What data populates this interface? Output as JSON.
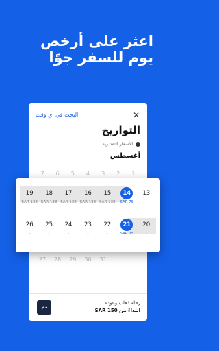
{
  "promo": {
    "headline": "اعثر على أرخص يوم للسفر جوًا"
  },
  "panel": {
    "anytime_link": "البحث في أي وقت",
    "close_icon": "close-icon",
    "title": "التواريخ",
    "estimated_note": "الأسعار التقديرية",
    "info_icon": "info-icon",
    "month": "أغسطس"
  },
  "faded_top_row": [
    "7",
    "6",
    "5",
    "4",
    "3",
    "2",
    "1"
  ],
  "faded_bottom_row": [
    "27",
    "28",
    "29",
    "30",
    "31",
    "",
    ""
  ],
  "calendar": {
    "weeks": [
      {
        "days": [
          {
            "day": "13",
            "price": "-",
            "selected": false,
            "in_range": false
          },
          {
            "day": "14",
            "price": "SAR 75",
            "selected": true,
            "in_range": true
          },
          {
            "day": "15",
            "price": "SAR 138",
            "selected": false,
            "in_range": true
          },
          {
            "day": "16",
            "price": "SAR 138",
            "selected": false,
            "in_range": true
          },
          {
            "day": "17",
            "price": "SAR 138",
            "selected": false,
            "in_range": true
          },
          {
            "day": "18",
            "price": "SAR 138",
            "selected": false,
            "in_range": true
          },
          {
            "day": "19",
            "price": "SAR 138",
            "selected": false,
            "in_range": true
          }
        ]
      },
      {
        "days": [
          {
            "day": "20",
            "price": "-",
            "selected": false,
            "in_range": true
          },
          {
            "day": "21",
            "price": "SAR 75",
            "selected": true,
            "in_range": true
          },
          {
            "day": "22",
            "price": "-",
            "selected": false,
            "in_range": false
          },
          {
            "day": "23",
            "price": "-",
            "selected": false,
            "in_range": false
          },
          {
            "day": "24",
            "price": "-",
            "selected": false,
            "in_range": false
          },
          {
            "day": "25",
            "price": "-",
            "selected": false,
            "in_range": false
          },
          {
            "day": "26",
            "price": "-",
            "selected": false,
            "in_range": false
          }
        ]
      }
    ]
  },
  "footer": {
    "trip_label": "رحلة ذهاب وعودة",
    "trip_price": "ابتداءً من SAR 150",
    "done_label": "تم"
  },
  "colors": {
    "brand": "#1460e6",
    "done_button": "#1b2740",
    "range": "#e6e6e6"
  }
}
